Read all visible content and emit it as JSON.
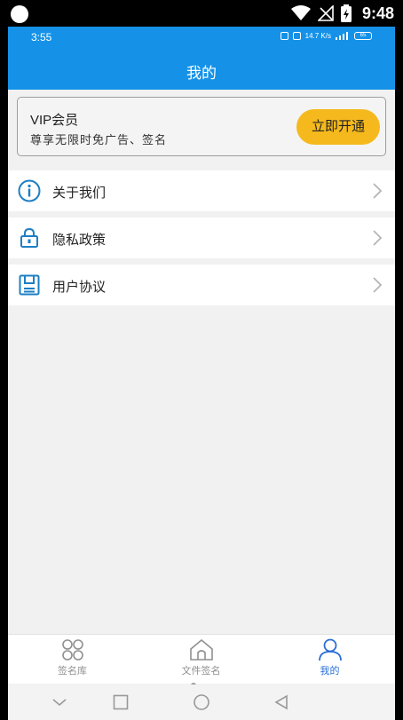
{
  "system_bar": {
    "time": "9:48"
  },
  "inner_status": {
    "time": "3:55",
    "speed": "14.7 K/s",
    "battery": "65"
  },
  "header": {
    "title": "我的"
  },
  "vip": {
    "title": "VIP会员",
    "subtitle": "尊享无限时免广告、签名",
    "button_label": "立即开通"
  },
  "menu": {
    "items": [
      {
        "label": "关于我们",
        "icon": "info-icon"
      },
      {
        "label": "隐私政策",
        "icon": "lock-icon"
      },
      {
        "label": "用户协议",
        "icon": "document-icon"
      }
    ]
  },
  "tabs": [
    {
      "label": "签名库",
      "icon": "grid-icon",
      "active": false
    },
    {
      "label": "文件签名",
      "icon": "home-icon",
      "active": false
    },
    {
      "label": "我的",
      "icon": "user-icon",
      "active": true
    }
  ],
  "colors": {
    "header_blue": "#1592e8",
    "vip_button": "#f5b91d",
    "icon_blue": "#1d7fc4",
    "active_tab": "#2a6fd6"
  }
}
